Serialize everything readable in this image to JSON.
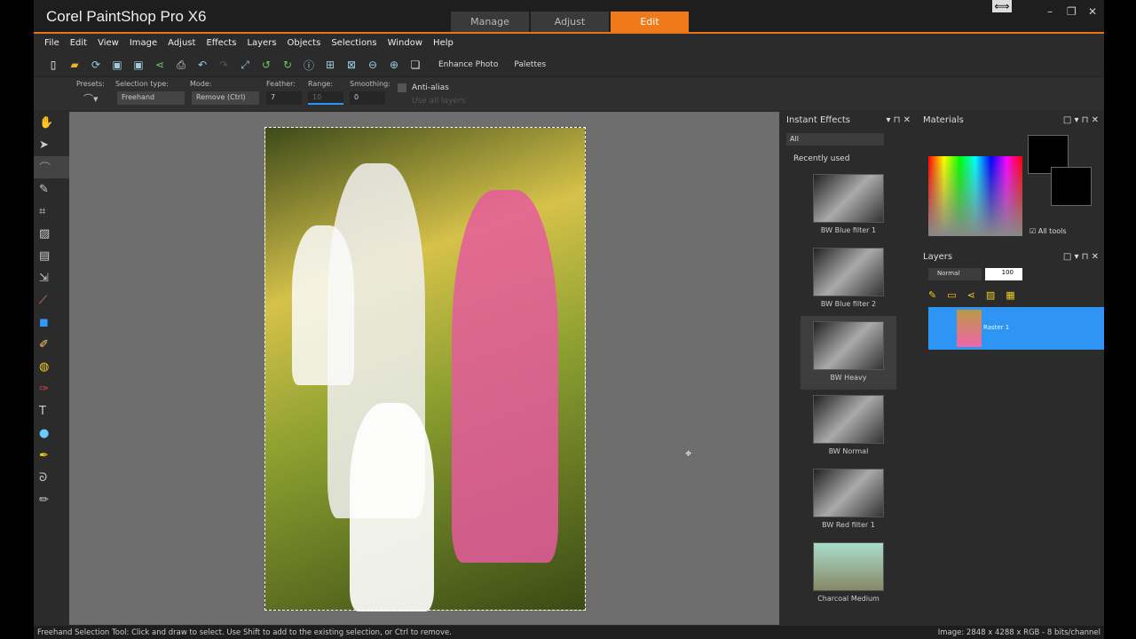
{
  "app": {
    "title": "Corel PaintShop Pro X6"
  },
  "workspace_tabs": [
    {
      "label": "Manage"
    },
    {
      "label": "Adjust"
    },
    {
      "label": "Edit",
      "active": true
    }
  ],
  "menu": [
    "File",
    "Edit",
    "View",
    "Image",
    "Adjust",
    "Effects",
    "Layers",
    "Objects",
    "Selections",
    "Window",
    "Help"
  ],
  "toolbar": {
    "enhance_photo": "Enhance Photo",
    "palettes": "Palettes"
  },
  "tool_options": {
    "presets_label": "Presets:",
    "selection_type_label": "Selection type:",
    "selection_type": "Freehand",
    "mode_label": "Mode:",
    "mode": "Remove (Ctrl)",
    "feather_label": "Feather:",
    "feather": "7",
    "range_label": "Range:",
    "range": "10",
    "smoothing_label": "Smoothing:",
    "smoothing": "0",
    "anti_alias": "Anti-alias",
    "use_all_layers": "Use all layers"
  },
  "instant_effects": {
    "title": "Instant Effects",
    "filter": "All",
    "section": "Recently used",
    "items": [
      {
        "label": "BW Blue filter 1"
      },
      {
        "label": "BW Blue filter 2"
      },
      {
        "label": "BW Heavy",
        "selected": true
      },
      {
        "label": "BW Normal"
      },
      {
        "label": "BW Red filter 1"
      },
      {
        "label": "Charcoal Medium"
      }
    ]
  },
  "materials": {
    "title": "Materials",
    "all_tools": "All tools"
  },
  "layers": {
    "title": "Layers",
    "blend_mode": "Normal",
    "opacity": "100",
    "items": [
      {
        "name": "Raster 1",
        "selected": true
      }
    ]
  },
  "status": {
    "hint": "Freehand Selection Tool: Click and draw to select. Use Shift to add to the existing selection, or Ctrl to remove.",
    "image_info": "Image:  2848 x 4288 x RGB - 8 bits/channel"
  },
  "colors": {
    "accent": "#f07a1a",
    "layer_selected": "#2f95f5"
  }
}
